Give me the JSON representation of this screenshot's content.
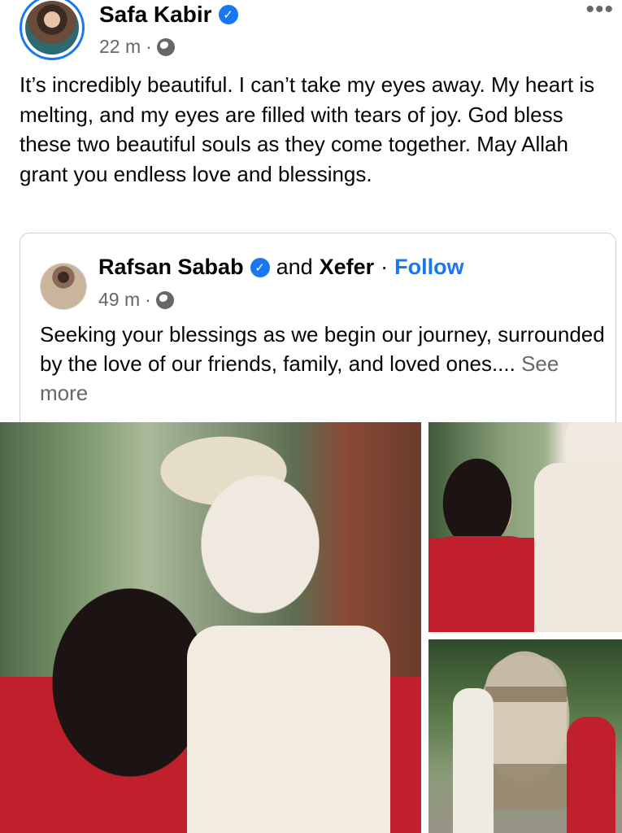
{
  "post": {
    "author": "Safa Kabir",
    "time": "22 m",
    "separator": "·",
    "menu_icon": "more-horizontal-icon",
    "text": "It’s incredibly beautiful. I can’t take my eyes away. My heart is melting, and my eyes are filled with tears of joy. God bless these two beautiful souls as they come together. May Allah grant you endless love and blessings."
  },
  "shared": {
    "author": "Rafsan Sabab",
    "and": "and",
    "coauthor": "Xefer",
    "separator": "·",
    "follow": "Follow",
    "time": "49 m",
    "time_separator": "·",
    "text": "Seeking your blessings as we begin our journey, surrounded by the love of our friends, family, and loved ones....",
    "see_more": "See more"
  },
  "verified_glyph": "✓",
  "colors": {
    "accent": "#1877f2",
    "secondary_text": "#65676b"
  }
}
